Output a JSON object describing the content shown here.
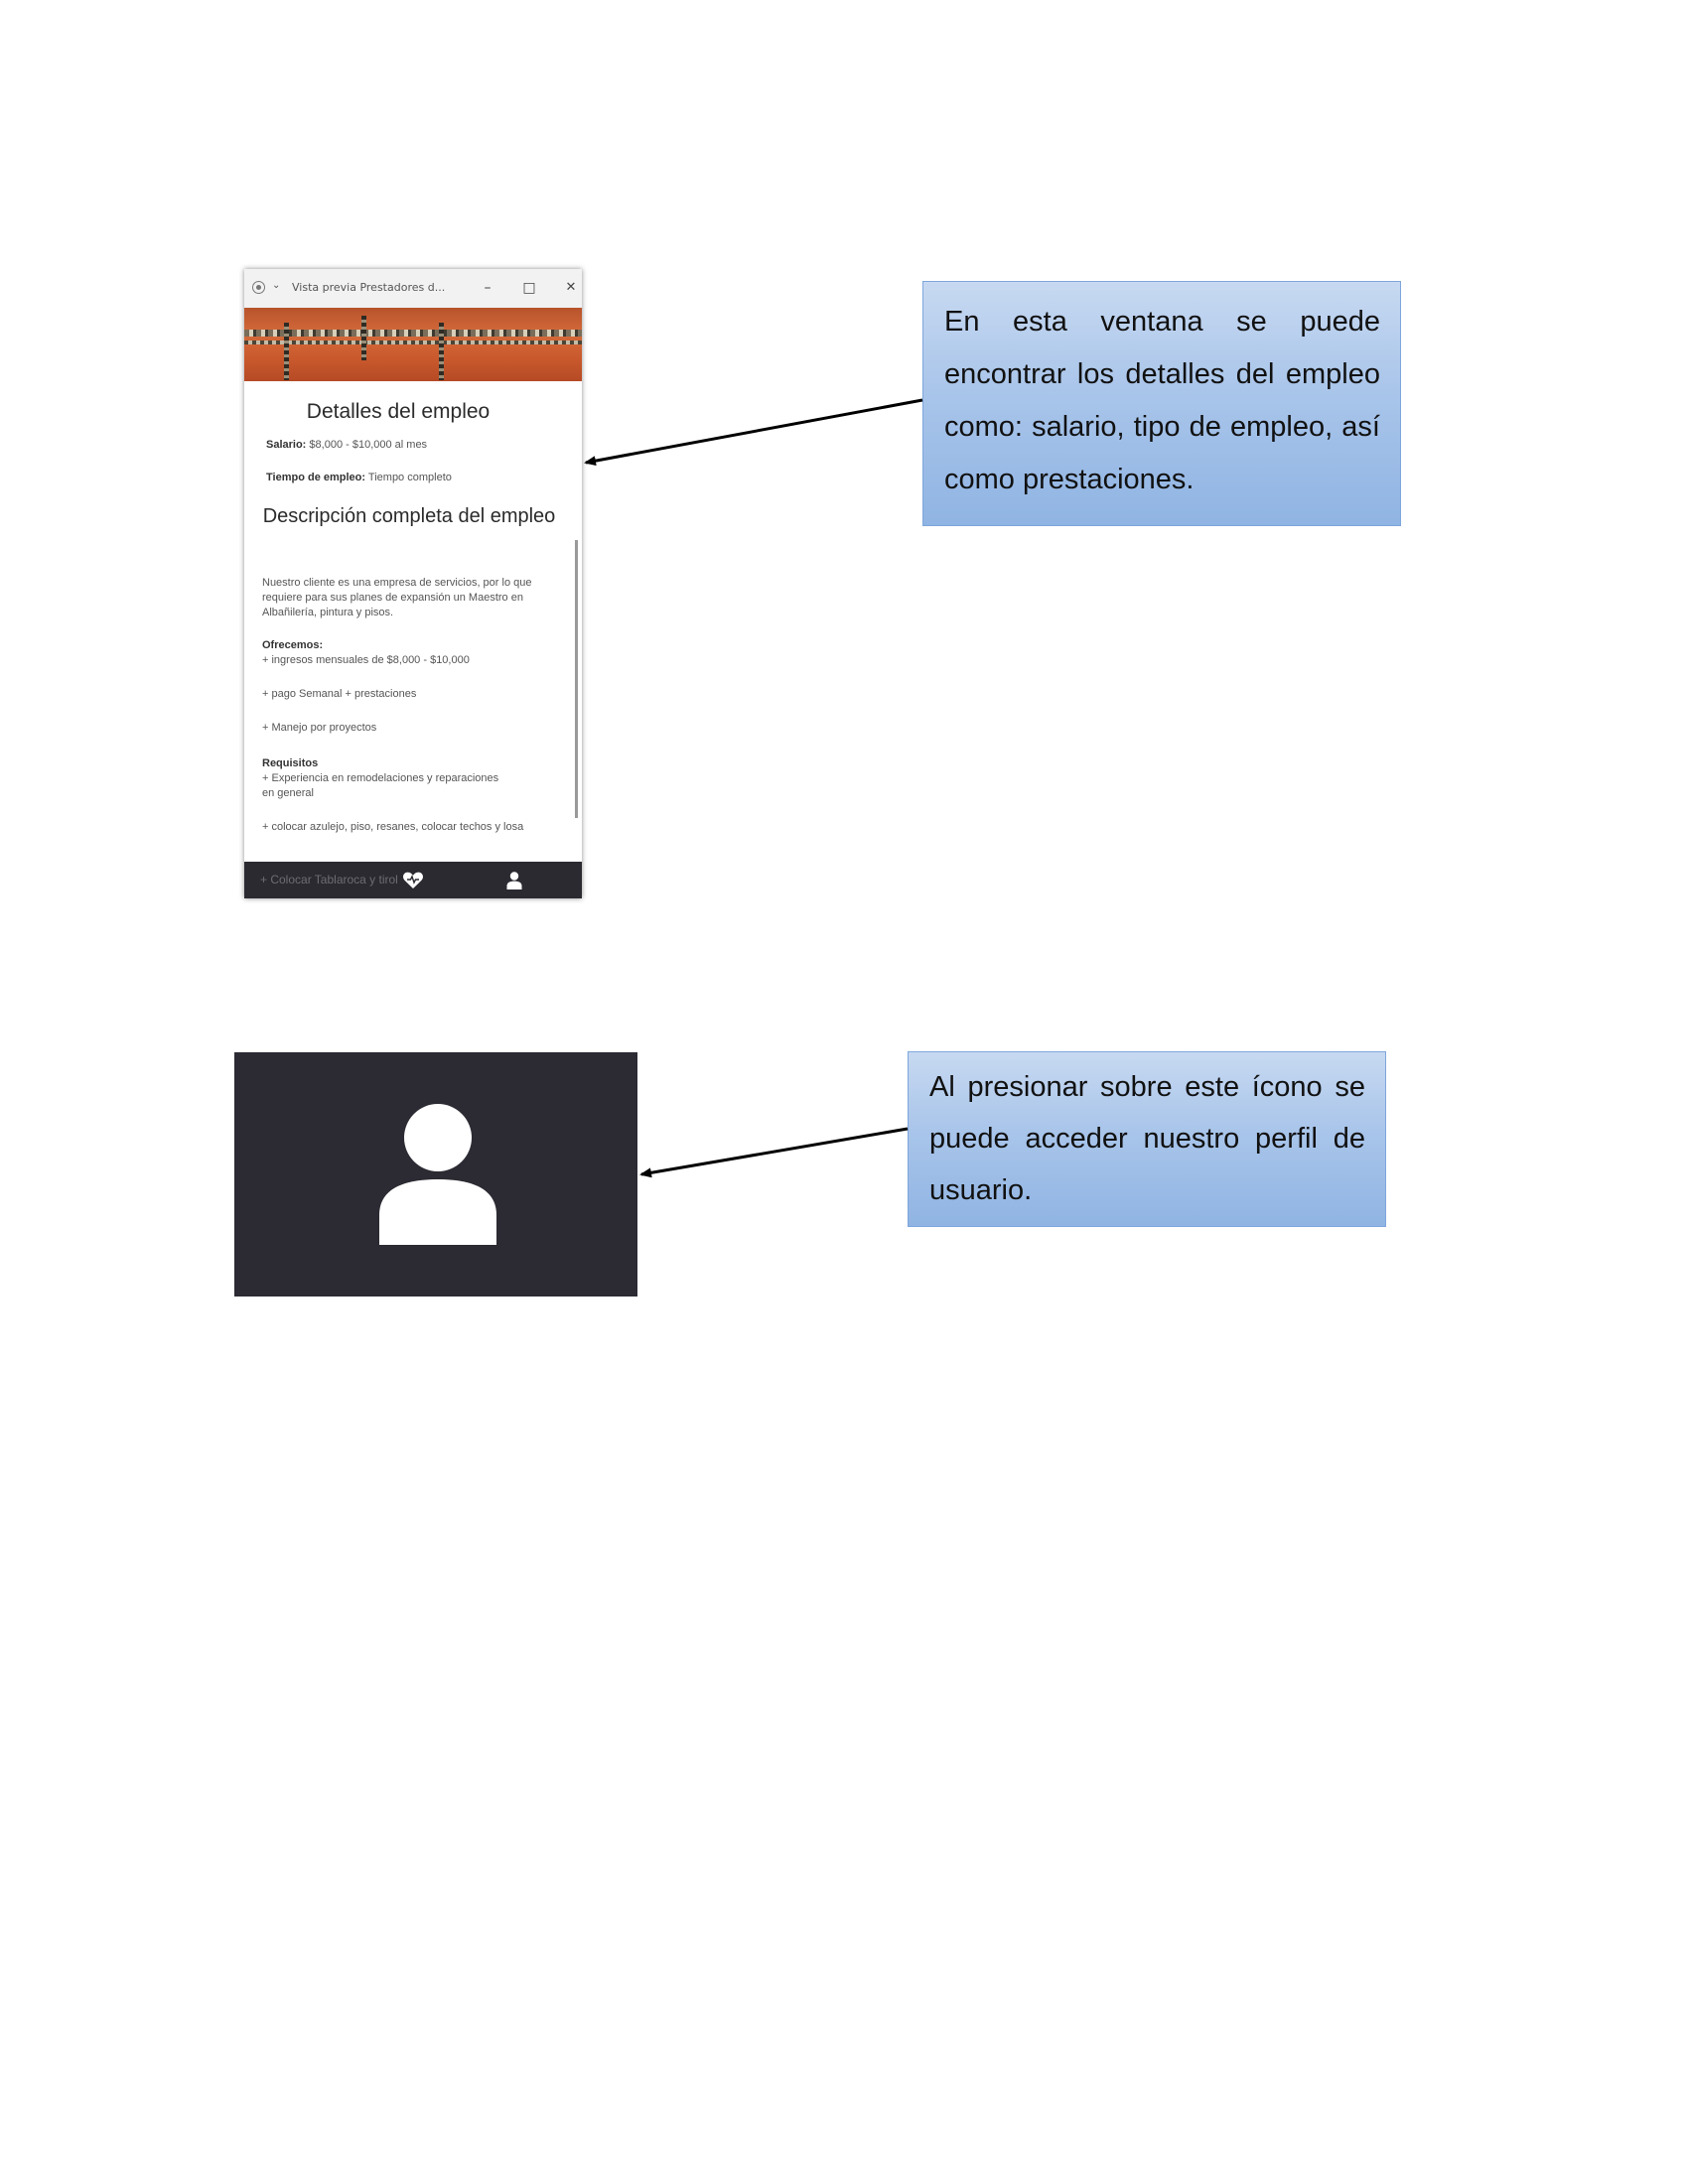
{
  "window": {
    "title": "Vista previa Prestadores d...",
    "minimize_glyph": "–",
    "maximize_glyph": "□",
    "close_glyph": "✕",
    "chevron_glyph": "⌄"
  },
  "job": {
    "heading": "Detalles del empleo",
    "salary_label": "Salario:",
    "salary_value": "$8,000 - $10,000 al mes",
    "type_label": "Tiempo de empleo:",
    "type_value": "Tiempo completo",
    "description_heading": "Descripción completa del empleo",
    "description_text": "Nuestro cliente es una empresa de servicios, por lo que requiere para sus planes de expansión un Maestro en Albañilería, pintura y pisos.",
    "offers_heading": "Ofrecemos:",
    "offers": [
      "+ ingresos mensuales de $8,000 - $10,000",
      "+ pago Semanal + prestaciones",
      "+ Manejo por proyectos"
    ],
    "requirements_heading": "Requisitos",
    "requirements": [
      "+ Experiencia en remodelaciones y reparaciones en general",
      "+ colocar azulejo, piso, resanes, colocar techos y losa"
    ],
    "bottom_ghost_text": "+ Colocar Tablaroca y tirol"
  },
  "nav": {
    "icons": [
      "heart-icon",
      "user-icon"
    ]
  },
  "callouts": {
    "details": "En esta ventana se puede encontrar los detalles del empleo como: salario, tipo de empleo, así como prestaciones.",
    "profile": "Al presionar sobre este ícono se puede acceder nuestro perfil de usuario."
  },
  "colors": {
    "navbar": "#2b2a31",
    "callout_fill": "#a9c5ea",
    "callout_border": "#7ea6dc",
    "banner_brick": "#c9592d"
  }
}
